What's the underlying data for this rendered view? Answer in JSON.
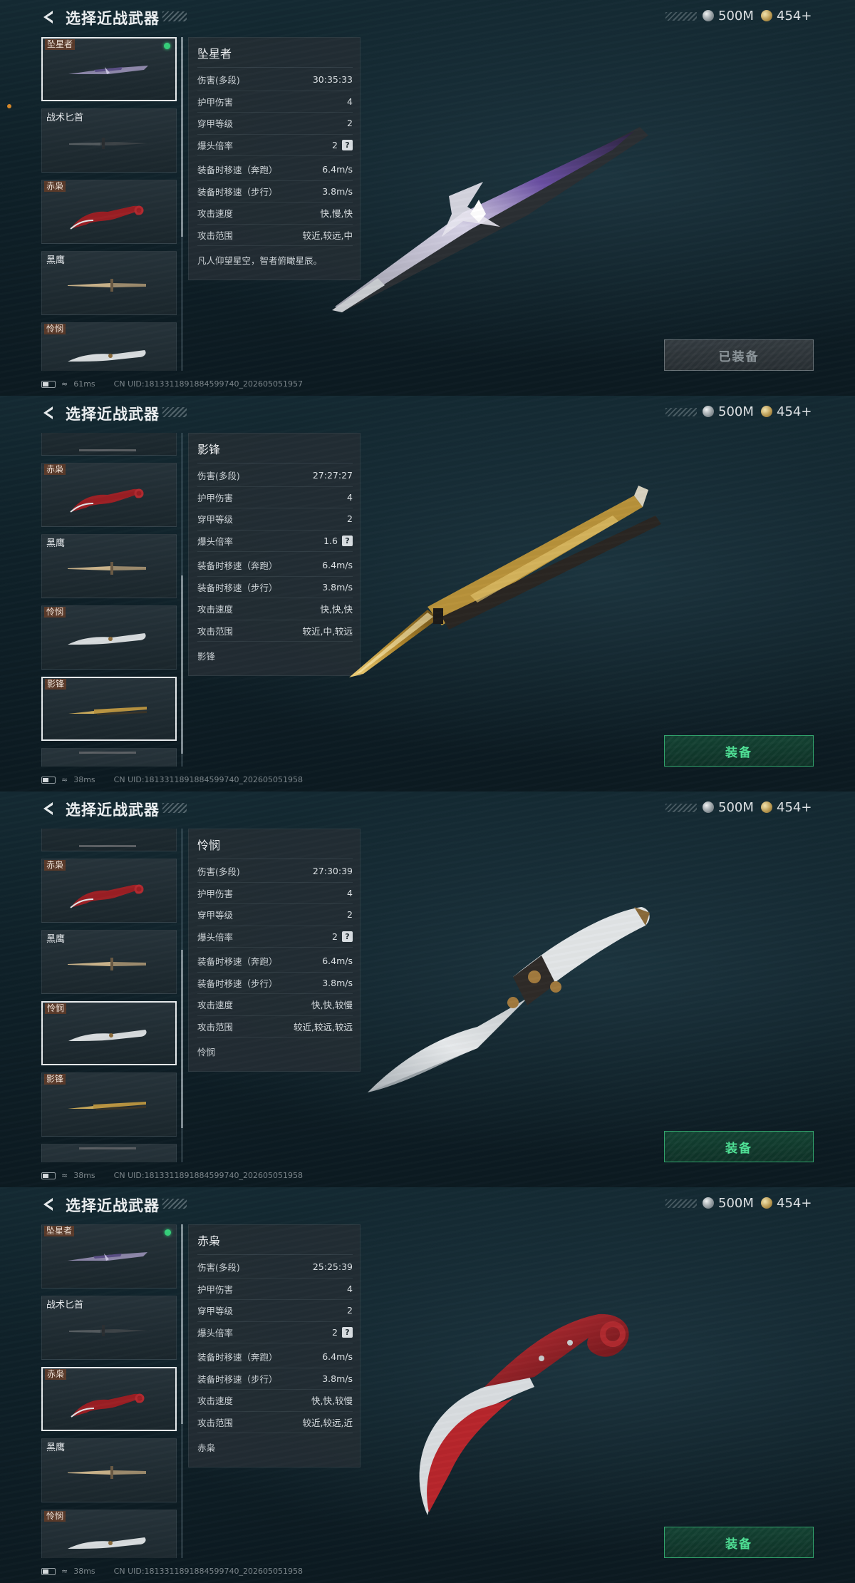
{
  "colors": {
    "accent_green": "#4fe296",
    "equipped_dot": "#36d17b",
    "tag_bg": "#5a3a2a"
  },
  "header": {
    "title": "选择近战武器",
    "silver": "500M",
    "gold": "454+"
  },
  "panels": [
    {
      "cards": [
        {
          "label": "坠星者",
          "style": "tag",
          "knife": "purple-blade-icon",
          "selected": true,
          "equipped": true
        },
        {
          "label": "战术匕首",
          "style": "plain",
          "knife": "dark-dagger-icon"
        },
        {
          "label": "赤枭",
          "style": "tag",
          "knife": "red-karambit-icon"
        },
        {
          "label": "黑鹰",
          "style": "plain",
          "knife": "bowie-knife-icon"
        },
        {
          "label": "怜悯",
          "style": "tag",
          "knife": "white-blade-icon"
        }
      ],
      "stats": {
        "name": "坠星者",
        "rows": [
          {
            "label": "伤害(多段)",
            "value": "30:35:33"
          },
          {
            "label": "护甲伤害",
            "value": "4"
          },
          {
            "label": "穿甲等级",
            "value": "2"
          },
          {
            "label": "爆头倍率",
            "value": "2"
          },
          {
            "label": "装备时移速（奔跑）",
            "value": "6.4m/s"
          },
          {
            "label": "装备时移速（步行）",
            "value": "3.8m/s"
          },
          {
            "label": "攻击速度",
            "value": "快,慢,快"
          },
          {
            "label": "攻击范围",
            "value": "较近,较远,中"
          }
        ],
        "desc": "凡人仰望星空，智者俯瞰星辰。"
      },
      "button": "已装备",
      "button_equipped": true,
      "ping": "61ms",
      "uid": "CN UID:1813311891884599740_202605051957"
    },
    {
      "cards": [
        {
          "label": "",
          "style": "plain",
          "knife": "partial-knife-icon",
          "partial": true
        },
        {
          "label": "赤枭",
          "style": "tag",
          "knife": "red-karambit-icon"
        },
        {
          "label": "黑鹰",
          "style": "plain",
          "knife": "bowie-knife-icon"
        },
        {
          "label": "怜悯",
          "style": "tag",
          "knife": "white-blade-icon"
        },
        {
          "label": "影锋",
          "style": "tag",
          "knife": "gold-balisong-icon",
          "selected": true
        },
        {
          "label": "",
          "style": "plain",
          "knife": "partial-knife-icon",
          "partial": true
        }
      ],
      "stats": {
        "name": "影锋",
        "rows": [
          {
            "label": "伤害(多段)",
            "value": "27:27:27"
          },
          {
            "label": "护甲伤害",
            "value": "4"
          },
          {
            "label": "穿甲等级",
            "value": "2"
          },
          {
            "label": "爆头倍率",
            "value": "1.6"
          },
          {
            "label": "装备时移速（奔跑）",
            "value": "6.4m/s"
          },
          {
            "label": "装备时移速（步行）",
            "value": "3.8m/s"
          },
          {
            "label": "攻击速度",
            "value": "快,快,快"
          },
          {
            "label": "攻击范围",
            "value": "较近,中,较远"
          }
        ],
        "desc": "影锋"
      },
      "button": "装备",
      "button_equipped": false,
      "ping": "38ms",
      "uid": "CN UID:1813311891884599740_202605051958"
    },
    {
      "cards": [
        {
          "label": "",
          "style": "plain",
          "knife": "partial-knife-icon",
          "partial": true
        },
        {
          "label": "赤枭",
          "style": "tag",
          "knife": "red-karambit-icon"
        },
        {
          "label": "黑鹰",
          "style": "plain",
          "knife": "bowie-knife-icon"
        },
        {
          "label": "怜悯",
          "style": "tag",
          "knife": "white-blade-icon",
          "selected": true
        },
        {
          "label": "影锋",
          "style": "tag",
          "knife": "gold-balisong-icon"
        },
        {
          "label": "",
          "style": "plain",
          "knife": "partial-knife-icon",
          "partial": true
        }
      ],
      "stats": {
        "name": "怜悯",
        "rows": [
          {
            "label": "伤害(多段)",
            "value": "27:30:39"
          },
          {
            "label": "护甲伤害",
            "value": "4"
          },
          {
            "label": "穿甲等级",
            "value": "2"
          },
          {
            "label": "爆头倍率",
            "value": "2"
          },
          {
            "label": "装备时移速（奔跑）",
            "value": "6.4m/s"
          },
          {
            "label": "装备时移速（步行）",
            "value": "3.8m/s"
          },
          {
            "label": "攻击速度",
            "value": "快,快,较慢"
          },
          {
            "label": "攻击范围",
            "value": "较近,较远,较远"
          }
        ],
        "desc": "怜悯"
      },
      "button": "装备",
      "button_equipped": false,
      "ping": "38ms",
      "uid": "CN UID:1813311891884599740_202605051958"
    },
    {
      "cards": [
        {
          "label": "坠星者",
          "style": "tag",
          "knife": "purple-blade-icon",
          "equipped": true
        },
        {
          "label": "战术匕首",
          "style": "plain",
          "knife": "dark-dagger-icon"
        },
        {
          "label": "赤枭",
          "style": "tag",
          "knife": "red-karambit-icon",
          "selected": true
        },
        {
          "label": "黑鹰",
          "style": "plain",
          "knife": "bowie-knife-icon"
        },
        {
          "label": "怜悯",
          "style": "tag",
          "knife": "white-blade-icon"
        }
      ],
      "stats": {
        "name": "赤枭",
        "rows": [
          {
            "label": "伤害(多段)",
            "value": "25:25:39"
          },
          {
            "label": "护甲伤害",
            "value": "4"
          },
          {
            "label": "穿甲等级",
            "value": "2"
          },
          {
            "label": "爆头倍率",
            "value": "2"
          },
          {
            "label": "装备时移速（奔跑）",
            "value": "6.4m/s"
          },
          {
            "label": "装备时移速（步行）",
            "value": "3.8m/s"
          },
          {
            "label": "攻击速度",
            "value": "快,快,较慢"
          },
          {
            "label": "攻击范围",
            "value": "较近,较远,近"
          }
        ],
        "desc": "赤枭"
      },
      "button": "装备",
      "button_equipped": false,
      "ping": "38ms",
      "uid": "CN UID:1813311891884599740_202605051958"
    }
  ]
}
